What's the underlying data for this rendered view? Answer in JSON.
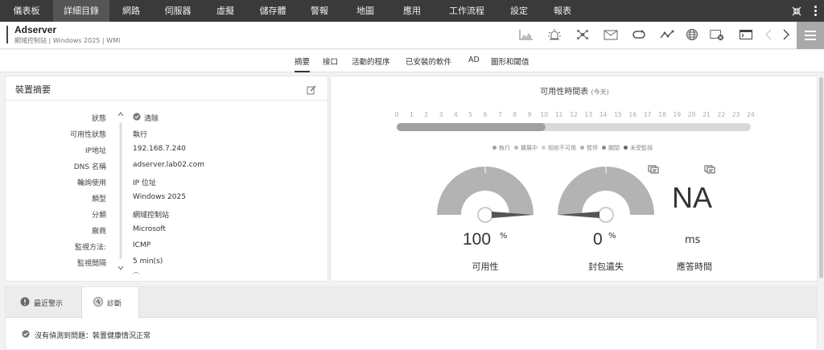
{
  "topnav": {
    "items": [
      "儀表板",
      "詳細目錄",
      "網路",
      "伺服器",
      "虛擬",
      "儲存體",
      "警報",
      "地圖",
      "應用",
      "工作流程",
      "設定",
      "報表"
    ],
    "active_index": 1
  },
  "header": {
    "title": "Adserver",
    "subtitle": "網域控制站 | Windows 2025 | WMI",
    "tools": [
      "chart-icon",
      "alarm-icon",
      "network-icon",
      "mail-icon",
      "loop-icon",
      "graph-icon",
      "globe-icon",
      "window-close-icon",
      "terminal-icon",
      "chevron-left-icon",
      "chevron-right-icon"
    ]
  },
  "tabs": {
    "items": [
      "摘要",
      "接口",
      "活動的程序",
      "已安裝的軟件",
      "AD",
      "圖形和閾值"
    ],
    "active_index": 0
  },
  "summary": {
    "title": "裝置摘要",
    "rows": [
      {
        "label": "狀態",
        "value": "清除"
      },
      {
        "label": "可用性狀態",
        "value": "執行"
      },
      {
        "label": "IP地址",
        "value": "192.168.7.240"
      },
      {
        "label": "DNS 名稱",
        "value": "adserver.lab02.com"
      },
      {
        "label": "輪詢使用",
        "value": "IP 位址"
      },
      {
        "label": "類型",
        "value": "Windows 2025"
      },
      {
        "label": "分類",
        "value": "網域控制站"
      },
      {
        "label": "廠商",
        "value": "Microsoft"
      },
      {
        "label": "監視方法:",
        "value": "ICMP"
      },
      {
        "label": "監視間隔",
        "value": "5 min(s)"
      }
    ]
  },
  "availability": {
    "title": "可用性時間表",
    "title_suffix": "(今天)",
    "hours": [
      "0",
      "1",
      "2",
      "3",
      "4",
      "5",
      "6",
      "7",
      "8",
      "9",
      "10",
      "11",
      "12",
      "13",
      "14",
      "15",
      "16",
      "17",
      "18",
      "19",
      "20",
      "21",
      "22",
      "23",
      "24"
    ],
    "up_fraction": 0.42,
    "legend": [
      {
        "label": "執行",
        "color": "#a0a0a0"
      },
      {
        "label": "擴展中",
        "color": "#b8b8b8"
      },
      {
        "label": "相依不可用",
        "color": "#cfcfcf"
      },
      {
        "label": "暫停",
        "color": "#b0b0b0"
      },
      {
        "label": "關閉",
        "color": "#8a8a8a"
      },
      {
        "label": "未受監視",
        "color": "#666666"
      }
    ]
  },
  "gauges": [
    {
      "value": "100",
      "unit": "%",
      "label": "可用性",
      "level": 1.0
    },
    {
      "value": "0",
      "unit": "%",
      "label": "封包遺失",
      "level": 0.0
    },
    {
      "value": "NA",
      "unit": "ms",
      "label": "應答時間"
    }
  ],
  "bottom": {
    "tabs": [
      "最近警示",
      "診斷"
    ],
    "active_index": 1,
    "message": "沒有偵測到問題：裝置健康情況正常"
  },
  "colors": {
    "nav_bg": "#3a3a3a",
    "nav_active": "#555555",
    "gauge_fill": "#b3b3b3",
    "bar_up": "#a0a0a0",
    "bar_rest": "#d9d9d9"
  }
}
